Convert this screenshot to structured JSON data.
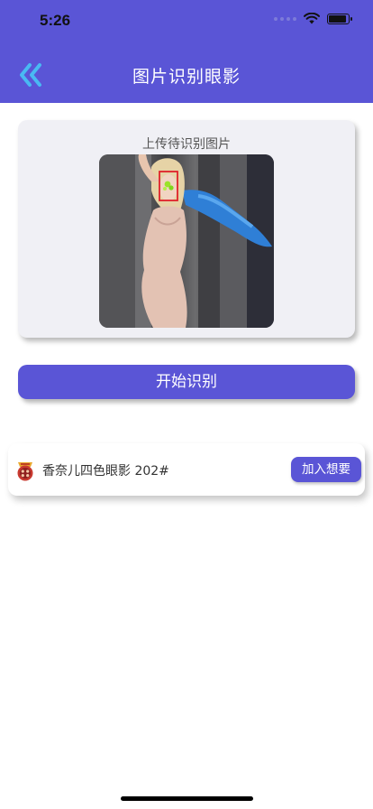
{
  "status_bar": {
    "time": "5:26"
  },
  "header": {
    "title": "图片识别眼影"
  },
  "upload": {
    "label": "上传待识别图片"
  },
  "actions": {
    "start_label": "开始识别"
  },
  "result": {
    "product_name": "香奈儿四色眼影 202#",
    "add_label": "加入想要"
  },
  "colors": {
    "accent": "#5a55d6",
    "card_bg": "#f0f0f5",
    "text": "#333333"
  },
  "icons": {
    "back": "double-chevron-left-icon",
    "wifi": "wifi-icon",
    "battery": "battery-icon",
    "signal": "signal-dots-icon",
    "brand": "chanel-eyeshadow-icon"
  }
}
